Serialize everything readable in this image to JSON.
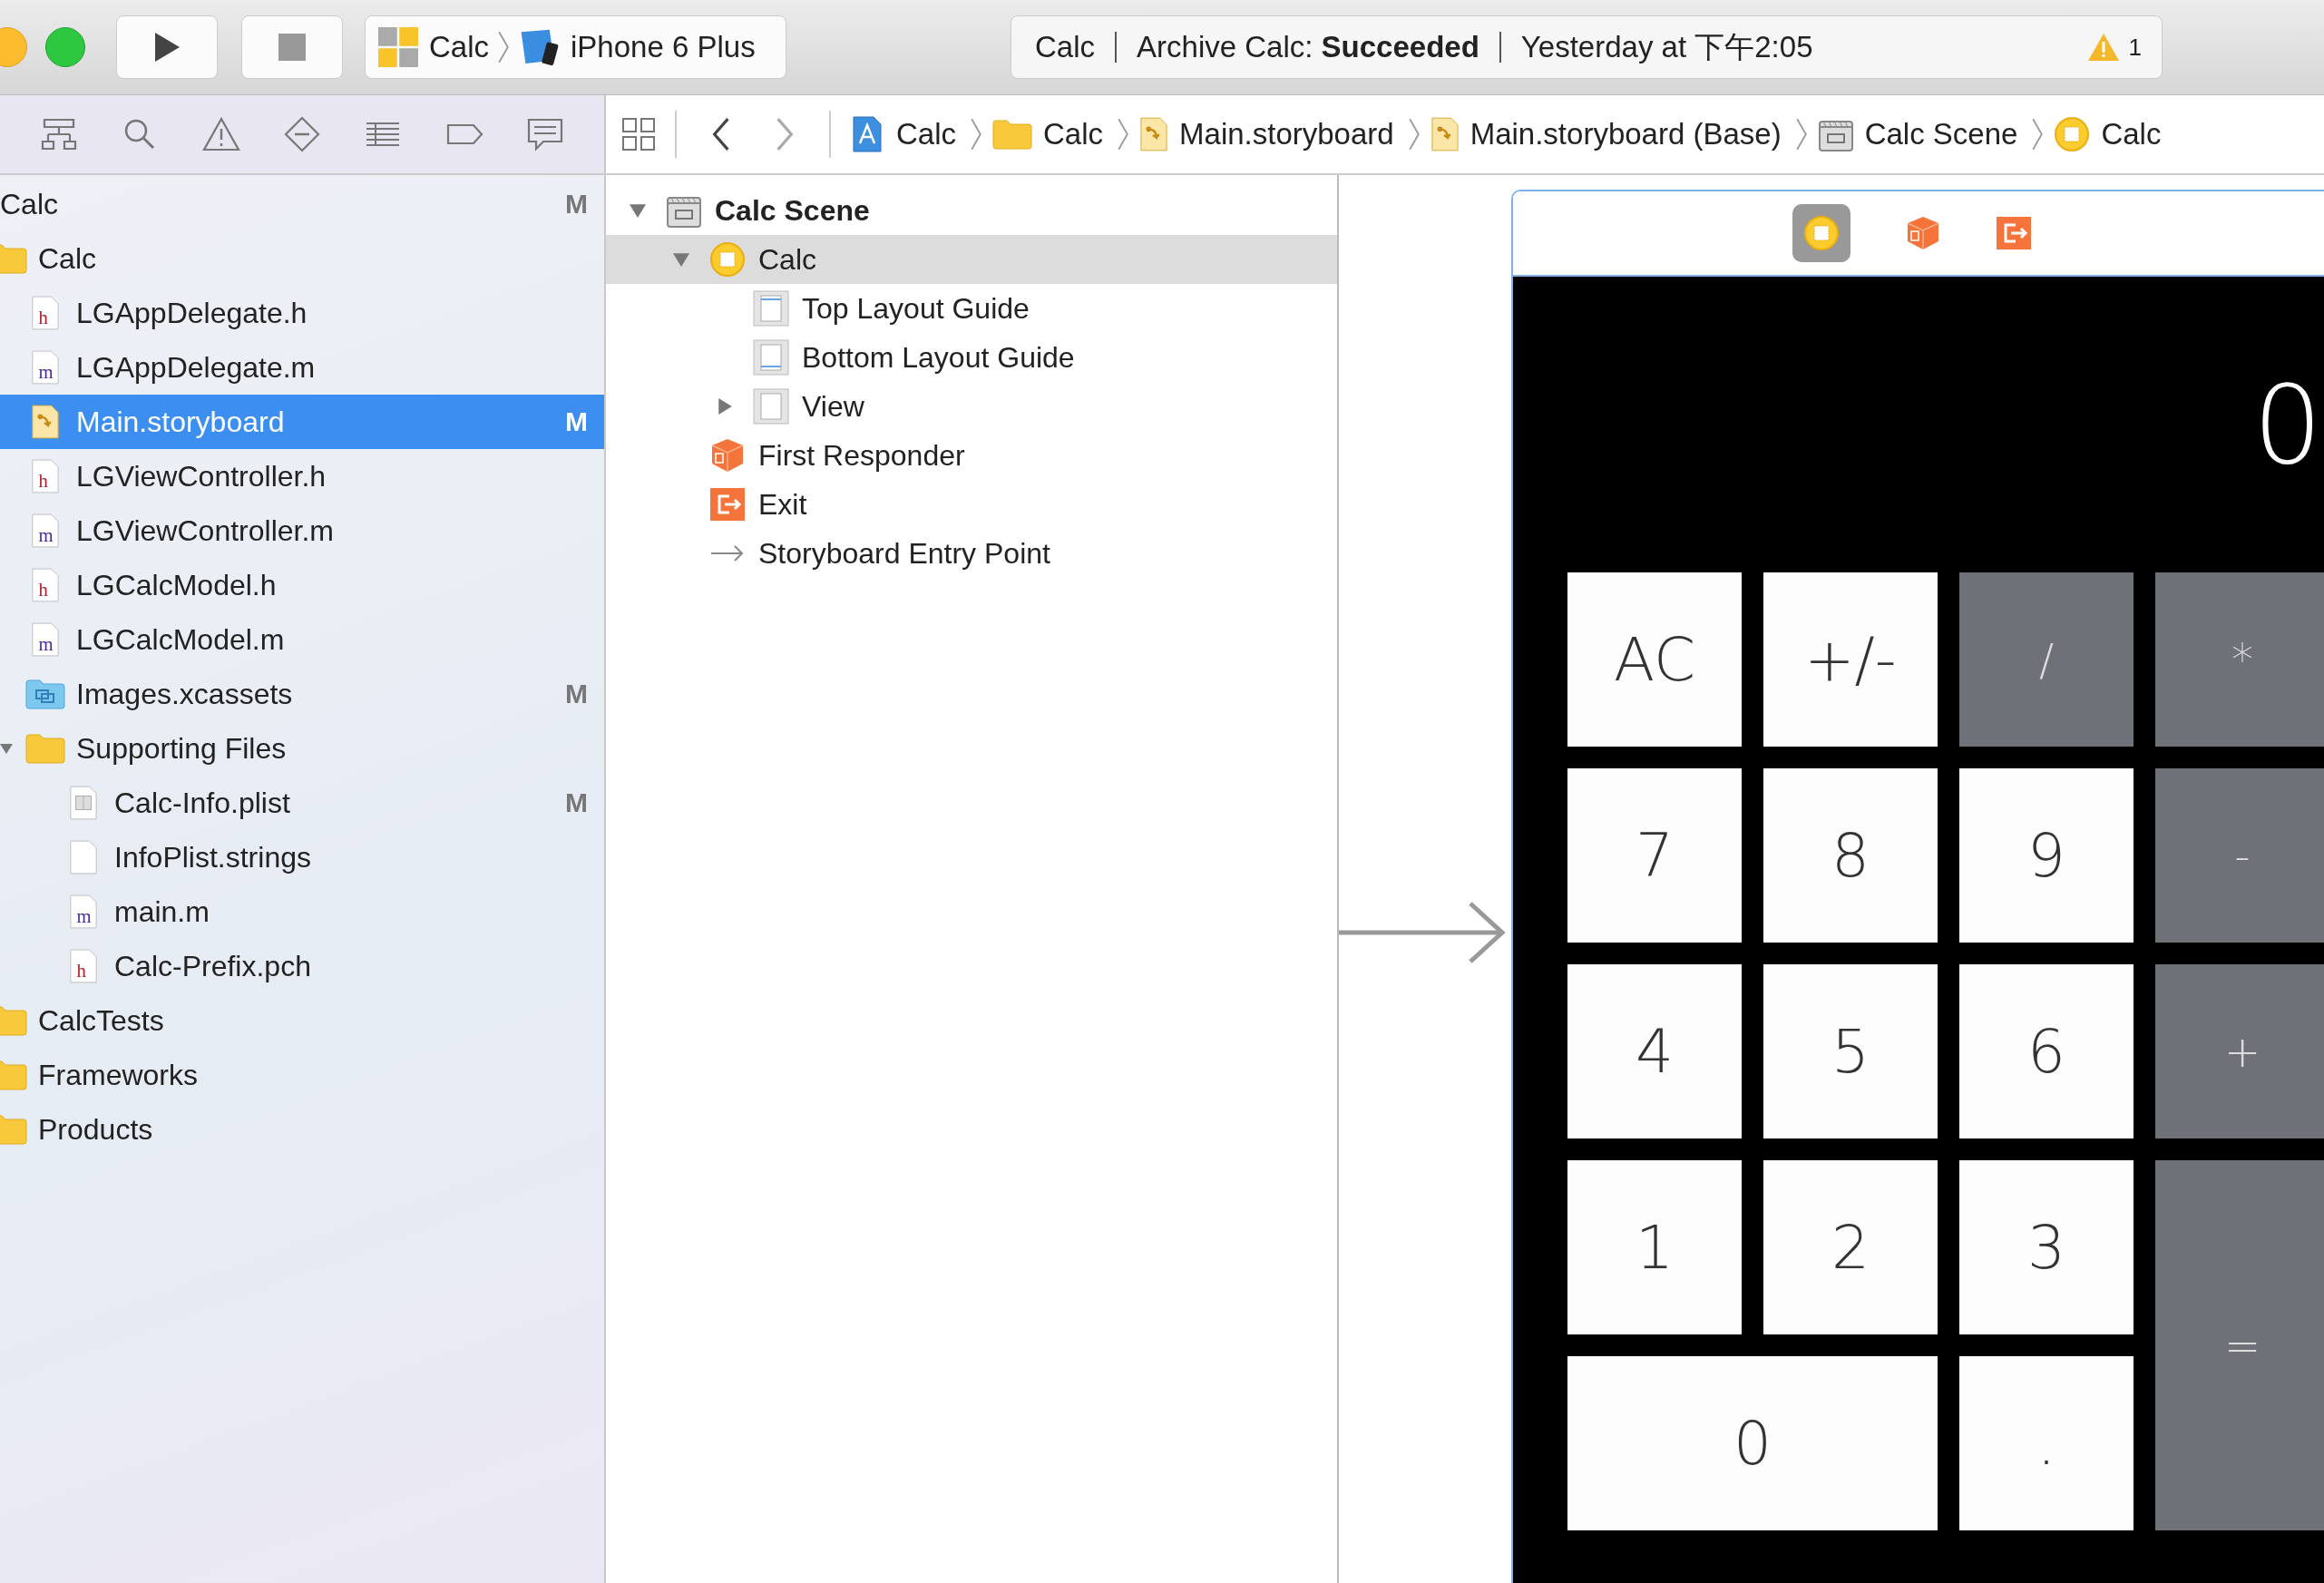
{
  "toolbar": {
    "scheme": {
      "target": "Calc",
      "device": "iPhone 6 Plus"
    },
    "activity": {
      "project": "Calc",
      "status": "Archive Calc: **Succeeded**",
      "time": "Yesterday at 下午2:05",
      "warnings": "1"
    }
  },
  "jump_bar": [
    {
      "label": "Calc",
      "kind": "project"
    },
    {
      "label": "Calc",
      "kind": "folder"
    },
    {
      "label": "Main.storyboard",
      "kind": "storyboard"
    },
    {
      "label": "Main.storyboard (Base)",
      "kind": "storyboard"
    },
    {
      "label": "Calc Scene",
      "kind": "scene"
    },
    {
      "label": "Calc",
      "kind": "controller"
    }
  ],
  "navigator": {
    "items": [
      {
        "label": "Calc",
        "status": "M",
        "selected": false,
        "children": [
          {
            "label": "Calc",
            "kind": "folder",
            "selected": false,
            "children": [
              {
                "label": "LGAppDelegate.h",
                "kind": "h",
                "selected": false
              },
              {
                "label": "LGAppDelegate.m",
                "kind": "m",
                "selected": false
              },
              {
                "label": "Main.storyboard",
                "kind": "storyboard",
                "status": "M",
                "selected": true
              },
              {
                "label": "LGViewController.h",
                "kind": "h",
                "selected": false
              },
              {
                "label": "LGViewController.m",
                "kind": "m",
                "selected": false
              },
              {
                "label": "LGCalcModel.h",
                "kind": "h",
                "selected": false
              },
              {
                "label": "LGCalcModel.m",
                "kind": "m",
                "selected": false
              },
              {
                "label": "Images.xcassets",
                "kind": "xcassets",
                "status": "M",
                "selected": false
              },
              {
                "label": "Supporting Files",
                "kind": "folder",
                "expanded": true,
                "selected": false,
                "children": [
                  {
                    "label": "Calc-Info.plist",
                    "kind": "plist",
                    "status": "M",
                    "selected": false
                  },
                  {
                    "label": "InfoPlist.strings",
                    "kind": "strings",
                    "selected": false
                  },
                  {
                    "label": "main.m",
                    "kind": "m",
                    "selected": false
                  },
                  {
                    "label": "Calc-Prefix.pch",
                    "kind": "h",
                    "selected": false
                  }
                ]
              }
            ]
          },
          {
            "label": "CalcTests",
            "kind": "folder",
            "selected": false
          },
          {
            "label": "Frameworks",
            "kind": "folder",
            "selected": false
          },
          {
            "label": "Products",
            "kind": "folder",
            "selected": false
          }
        ]
      }
    ]
  },
  "outline": {
    "items": [
      {
        "label": "Calc Scene",
        "kind": "scene",
        "expanded": true,
        "selected": false,
        "children": [
          {
            "label": "Calc",
            "kind": "controller",
            "expanded": true,
            "selected": true,
            "children": [
              {
                "label": "Top Layout Guide",
                "kind": "top-guide",
                "selected": false
              },
              {
                "label": "Bottom Layout Guide",
                "kind": "bottom-guide",
                "selected": false
              },
              {
                "label": "View",
                "kind": "view",
                "expanded": false,
                "selected": false
              }
            ]
          },
          {
            "label": "First Responder",
            "kind": "responder",
            "selected": false
          },
          {
            "label": "Exit",
            "kind": "exit",
            "selected": false
          },
          {
            "label": "Storyboard Entry Point",
            "kind": "entry",
            "selected": false
          }
        ]
      }
    ]
  },
  "scene": {
    "display": "0",
    "keys": [
      {
        "label": "AC",
        "kind": "light"
      },
      {
        "label": "+/-",
        "kind": "light"
      },
      {
        "label": "/",
        "kind": "dark"
      },
      {
        "label": "*",
        "kind": "dark"
      },
      {
        "label": "7",
        "kind": "light"
      },
      {
        "label": "8",
        "kind": "light"
      },
      {
        "label": "9",
        "kind": "light"
      },
      {
        "label": "-",
        "kind": "dark"
      },
      {
        "label": "4",
        "kind": "light"
      },
      {
        "label": "5",
        "kind": "light"
      },
      {
        "label": "6",
        "kind": "light"
      },
      {
        "label": "+",
        "kind": "dark"
      },
      {
        "label": "1",
        "kind": "light"
      },
      {
        "label": "2",
        "kind": "light"
      },
      {
        "label": "3",
        "kind": "light"
      },
      {
        "label": "=",
        "kind": "dark-tall"
      },
      {
        "label": "0",
        "kind": "light-wide"
      },
      {
        "label": ".",
        "kind": "light"
      }
    ]
  }
}
